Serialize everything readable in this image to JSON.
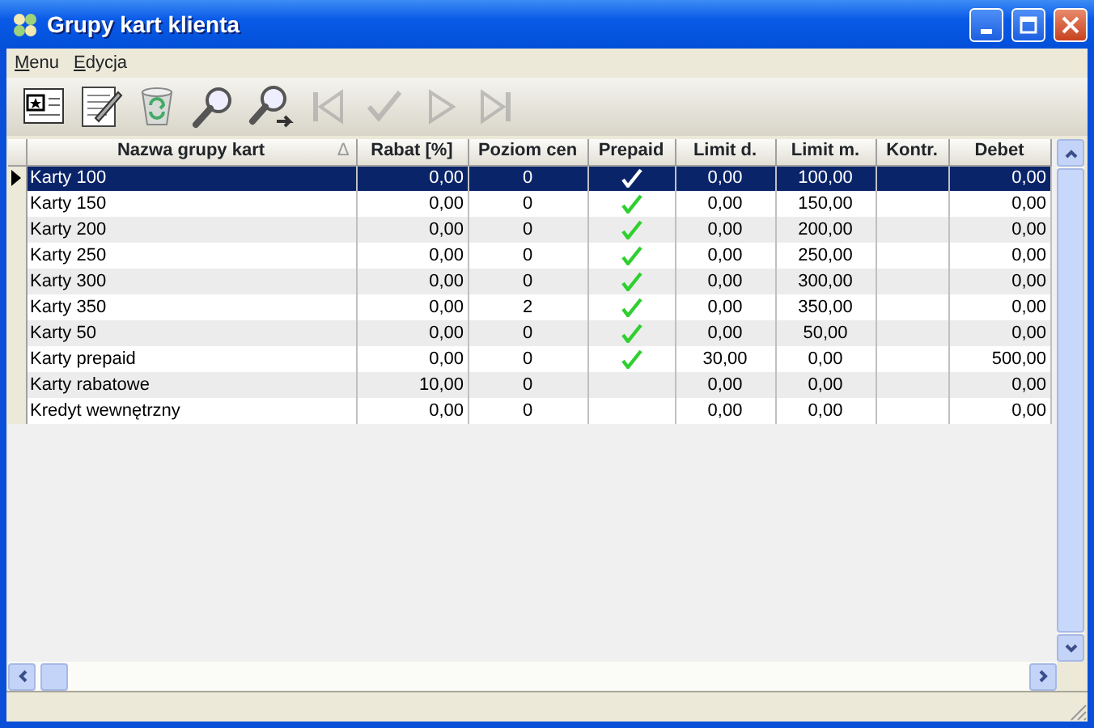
{
  "window": {
    "title": "Grupy kart klienta"
  },
  "menu": [
    "Menu",
    "Edycja"
  ],
  "toolbar": [
    {
      "kind": "card",
      "disabled": false
    },
    {
      "kind": "edit",
      "disabled": false
    },
    {
      "kind": "bin",
      "disabled": false
    },
    {
      "kind": "search",
      "disabled": false
    },
    {
      "kind": "search-next",
      "disabled": false
    },
    {
      "kind": "first",
      "disabled": true
    },
    {
      "kind": "check",
      "disabled": true
    },
    {
      "kind": "play",
      "disabled": true
    },
    {
      "kind": "last",
      "disabled": true
    }
  ],
  "table": {
    "columns": [
      "Nazwa grupy kart",
      "Rabat [%]",
      "Poziom cen",
      "Prepaid",
      "Limit d.",
      "Limit m.",
      "Kontr.",
      "Debet"
    ],
    "sort_mark": "∆",
    "rows": [
      {
        "name": "Karty 100",
        "rabat": "0,00",
        "poziom": "0",
        "prepaid": true,
        "limit_d": "0,00",
        "limit_m": "100,00",
        "debet": "0,00",
        "selected": true
      },
      {
        "name": "Karty 150",
        "rabat": "0,00",
        "poziom": "0",
        "prepaid": true,
        "limit_d": "0,00",
        "limit_m": "150,00",
        "debet": "0,00",
        "selected": false
      },
      {
        "name": "Karty 200",
        "rabat": "0,00",
        "poziom": "0",
        "prepaid": true,
        "limit_d": "0,00",
        "limit_m": "200,00",
        "debet": "0,00",
        "selected": false
      },
      {
        "name": "Karty 250",
        "rabat": "0,00",
        "poziom": "0",
        "prepaid": true,
        "limit_d": "0,00",
        "limit_m": "250,00",
        "debet": "0,00",
        "selected": false
      },
      {
        "name": "Karty 300",
        "rabat": "0,00",
        "poziom": "0",
        "prepaid": true,
        "limit_d": "0,00",
        "limit_m": "300,00",
        "debet": "0,00",
        "selected": false
      },
      {
        "name": "Karty 350",
        "rabat": "0,00",
        "poziom": "2",
        "prepaid": true,
        "limit_d": "0,00",
        "limit_m": "350,00",
        "debet": "0,00",
        "selected": false
      },
      {
        "name": "Karty 50",
        "rabat": "0,00",
        "poziom": "0",
        "prepaid": true,
        "limit_d": "0,00",
        "limit_m": "50,00",
        "debet": "0,00",
        "selected": false
      },
      {
        "name": "Karty prepaid",
        "rabat": "0,00",
        "poziom": "0",
        "prepaid": true,
        "limit_d": "30,00",
        "limit_m": "0,00",
        "debet": "500,00",
        "selected": false
      },
      {
        "name": "Karty rabatowe",
        "rabat": "10,00",
        "poziom": "0",
        "prepaid": false,
        "limit_d": "0,00",
        "limit_m": "0,00",
        "debet": "0,00",
        "selected": false
      },
      {
        "name": "Kredyt wewnętrzny",
        "rabat": "0,00",
        "poziom": "0",
        "prepaid": false,
        "limit_d": "0,00",
        "limit_m": "0,00",
        "debet": "0,00",
        "selected": false
      }
    ]
  }
}
